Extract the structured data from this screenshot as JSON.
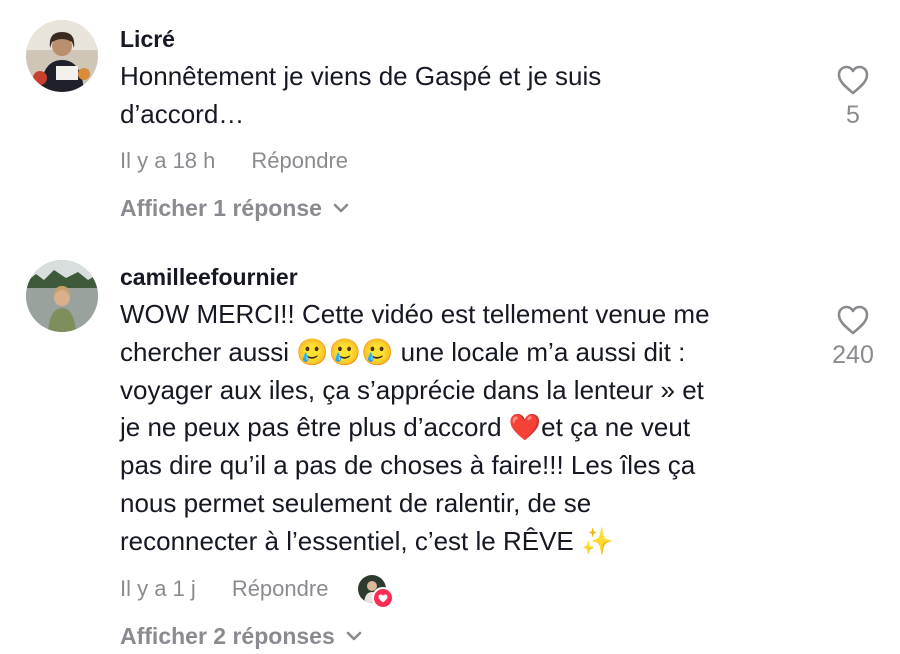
{
  "comments": [
    {
      "username": "Licré",
      "text": "Honnêtement je viens de Gaspé et je suis\nd’accord…",
      "time": "Il y a 18 h",
      "reply_label": "Répondre",
      "view_replies": "Afficher 1 réponse",
      "likes": "5",
      "avatar_icon": "user-avatar"
    },
    {
      "username": "camilleefournier",
      "text": "WOW MERCI!! Cette vidéo est tellement venue me\nchercher aussi 🥲🥲🥲 une locale m’a aussi dit :\nvoyager aux iles, ça s’apprécie dans la lenteur » et\nje ne peux pas être plus d’accord ❤️et ça ne veut\npas dire qu’il a pas de choses à faire!!! Les îles ça\nnous permet seulement de ralentir, de se\nreconnecter à l’essentiel, c’est le RÊVE ✨",
      "time": "Il y a 1 j",
      "reply_label": "Répondre",
      "view_replies": "Afficher 2 réponses",
      "likes": "240",
      "avatar_icon": "user-avatar",
      "creator_liked_icon": "creator-liked-heart-icon"
    }
  ],
  "colors": {
    "text_primary": "#161823",
    "text_secondary": "#8a8b91",
    "like_badge": "#fe2c55"
  }
}
